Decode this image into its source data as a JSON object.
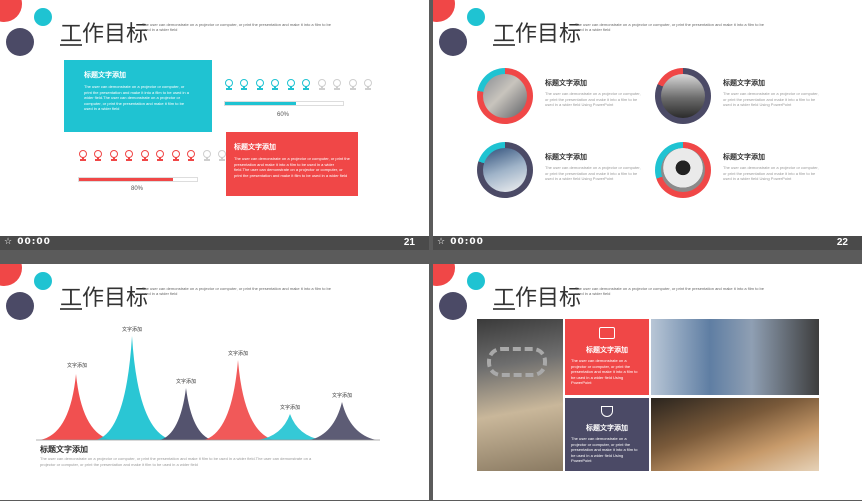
{
  "colors": {
    "red": "#f04747",
    "cyan": "#1fc3d2",
    "navy": "#4b4a66",
    "gray": "#cfcfcf"
  },
  "slides": [
    {
      "title": "工作目标",
      "subtitle": "The user can demonstrate on a projector or computer, or print the presentation and make it into a film to be used in a wider field",
      "time": "00:00",
      "number": "21",
      "card1": {
        "title": "标题文字添加",
        "text": "The user can demonstrate on a projector or computer, or print the presentation and make it into a film to be used in a wider field.The user can demonstrate on a projector or computer, or print the presentation and make it film to be used in a wider field"
      },
      "card2": {
        "title": "标题文字添加",
        "text": "The user can demonstrate on a projector or computer, or print the presentation and make it into a film to be used in a wider field.The user can demonstrate on a projector or computer, or print the presentation and make it film to be used in a wider field"
      },
      "progress1": {
        "percent_label": "60%",
        "value": 0.6
      },
      "progress2": {
        "percent_label": "80%",
        "value": 0.8
      }
    },
    {
      "title": "工作目标",
      "subtitle": "The user can demonstrate on a projector or computer, or print the presentation and make it into a film to be used in a wider field",
      "time": "00:00",
      "number": "22",
      "items": [
        {
          "title": "标题文字添加",
          "text": "The user can demonstrate on a projector or computer, or print the presentation and make it into a film to be used in a wider field Using PowerPoint"
        },
        {
          "title": "标题文字添加",
          "text": "The user can demonstrate on a projector or computer, or print the presentation and make it into a film to be used in a wider field Using PowerPoint"
        },
        {
          "title": "标题文字添加",
          "text": "The user can demonstrate on a projector or computer, or print the presentation and make it into a film to be used in a wider field Using PowerPoint"
        },
        {
          "title": "标题文字添加",
          "text": "The user can demonstrate on a projector or computer, or print the presentation and make it into a film to be used in a wider field Using PowerPoint"
        }
      ]
    },
    {
      "title": "工作目标",
      "subtitle": "The user can demonstrate on a projector or computer, or print the presentation and make it into a film to be used in a wider field",
      "peak_labels": [
        "文字添加",
        "文字添加",
        "文字添加",
        "文字添加",
        "文字添加",
        "文字添加"
      ],
      "footer_title": "标题文字添加",
      "footer_text": "The user can demonstrate on a projector or computer, or print the presentation and make it film to be used in a wider field.The user can demonstrate on a projector or computer, or print the presentation and make it film to be used in a wider field"
    },
    {
      "title": "工作目标",
      "subtitle": "The user can demonstrate on a projector or computer, or print the presentation and make it into a film to be used in a wider field",
      "tile1": {
        "title": "标题文字添加",
        "text": "The user can demonstrate on a projector or computer, or print the presentation and make it into a film to be used in a wider field Using PowerPoint"
      },
      "tile2": {
        "title": "标题文字添加",
        "text": "The user can demonstrate on a projector or computer, or print the presentation and make it into a film to be used in a wider field Using PowerPoint"
      }
    }
  ]
}
